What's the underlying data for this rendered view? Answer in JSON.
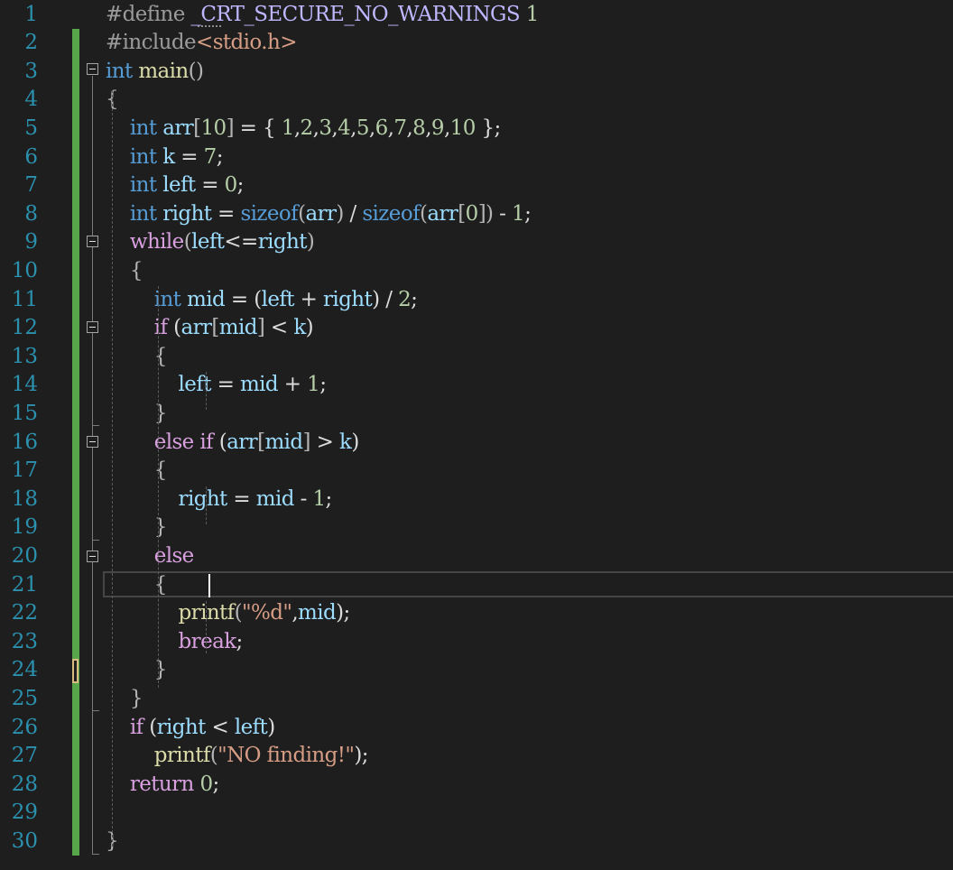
{
  "editor": {
    "language": "C",
    "theme_colors": {
      "background": "#1e1e1e",
      "line_number": "#2b91af",
      "keyword": "#569cd6",
      "control": "#d8a0df",
      "function": "#dcdcaa",
      "variable": "#9cdcfe",
      "number": "#b5cea8",
      "string": "#d69d85",
      "preprocessor": "#9b9b9b",
      "change_bar": "#57a64a"
    },
    "cursor": {
      "line": 21,
      "column": 2
    },
    "lines": [
      {
        "n": "1",
        "tokens": [
          [
            "pp",
            "#define "
          ],
          [
            "macro",
            "_CRT_SECURE_NO_WARNINGS"
          ],
          [
            "t",
            " "
          ],
          [
            "num",
            "1"
          ]
        ]
      },
      {
        "n": "2",
        "tokens": [
          [
            "pp",
            "#include"
          ],
          [
            "str",
            "<stdio.h>"
          ]
        ]
      },
      {
        "n": "3",
        "tokens": [
          [
            "kw",
            "int"
          ],
          [
            "t",
            " "
          ],
          [
            "fn",
            "main"
          ],
          [
            "punc",
            "()"
          ]
        ]
      },
      {
        "n": "4",
        "tokens": [
          [
            "punc",
            "{"
          ]
        ]
      },
      {
        "n": "5",
        "tokens": [
          [
            "t",
            "    "
          ],
          [
            "kw",
            "int"
          ],
          [
            "t",
            " "
          ],
          [
            "var",
            "arr"
          ],
          [
            "punc",
            "["
          ],
          [
            "num",
            "10"
          ],
          [
            "punc",
            "]"
          ],
          [
            "t",
            " = { "
          ],
          [
            "num",
            "1"
          ],
          [
            "t",
            ","
          ],
          [
            "num",
            "2"
          ],
          [
            "t",
            ","
          ],
          [
            "num",
            "3"
          ],
          [
            "t",
            ","
          ],
          [
            "num",
            "4"
          ],
          [
            "t",
            ","
          ],
          [
            "num",
            "5"
          ],
          [
            "t",
            ","
          ],
          [
            "num",
            "6"
          ],
          [
            "t",
            ","
          ],
          [
            "num",
            "7"
          ],
          [
            "t",
            ","
          ],
          [
            "num",
            "8"
          ],
          [
            "t",
            ","
          ],
          [
            "num",
            "9"
          ],
          [
            "t",
            ","
          ],
          [
            "num",
            "10"
          ],
          [
            "t",
            " };"
          ]
        ]
      },
      {
        "n": "6",
        "tokens": [
          [
            "t",
            "    "
          ],
          [
            "kw",
            "int"
          ],
          [
            "t",
            " "
          ],
          [
            "var",
            "k"
          ],
          [
            "t",
            " = "
          ],
          [
            "num",
            "7"
          ],
          [
            "t",
            ";"
          ]
        ]
      },
      {
        "n": "7",
        "tokens": [
          [
            "t",
            "    "
          ],
          [
            "kw",
            "int"
          ],
          [
            "t",
            " "
          ],
          [
            "var",
            "left"
          ],
          [
            "t",
            " = "
          ],
          [
            "num",
            "0"
          ],
          [
            "t",
            ";"
          ]
        ]
      },
      {
        "n": "8",
        "tokens": [
          [
            "t",
            "    "
          ],
          [
            "kw",
            "int"
          ],
          [
            "t",
            " "
          ],
          [
            "var",
            "right"
          ],
          [
            "t",
            " = "
          ],
          [
            "kw",
            "sizeof"
          ],
          [
            "punc",
            "("
          ],
          [
            "var",
            "arr"
          ],
          [
            "punc",
            ")"
          ],
          [
            "t",
            " / "
          ],
          [
            "kw",
            "sizeof"
          ],
          [
            "punc",
            "("
          ],
          [
            "var",
            "arr"
          ],
          [
            "punc",
            "["
          ],
          [
            "num",
            "0"
          ],
          [
            "punc",
            "])"
          ],
          [
            "t",
            " - "
          ],
          [
            "num",
            "1"
          ],
          [
            "t",
            ";"
          ]
        ]
      },
      {
        "n": "9",
        "tokens": [
          [
            "t",
            "    "
          ],
          [
            "ctl",
            "while"
          ],
          [
            "punc",
            "("
          ],
          [
            "var",
            "left"
          ],
          [
            "t",
            "<="
          ],
          [
            "var",
            "right"
          ],
          [
            "punc",
            ")"
          ]
        ]
      },
      {
        "n": "10",
        "tokens": [
          [
            "t",
            "    "
          ],
          [
            "punc",
            "{"
          ]
        ]
      },
      {
        "n": "11",
        "tokens": [
          [
            "t",
            "        "
          ],
          [
            "kw",
            "int"
          ],
          [
            "t",
            " "
          ],
          [
            "var",
            "mid"
          ],
          [
            "t",
            " = ("
          ],
          [
            "var",
            "left"
          ],
          [
            "t",
            " + "
          ],
          [
            "var",
            "right"
          ],
          [
            "t",
            ") / "
          ],
          [
            "num",
            "2"
          ],
          [
            "t",
            ";"
          ]
        ]
      },
      {
        "n": "12",
        "tokens": [
          [
            "t",
            "        "
          ],
          [
            "ctl",
            "if"
          ],
          [
            "t",
            " ("
          ],
          [
            "var",
            "arr"
          ],
          [
            "punc",
            "["
          ],
          [
            "var",
            "mid"
          ],
          [
            "punc",
            "]"
          ],
          [
            "t",
            " < "
          ],
          [
            "var",
            "k"
          ],
          [
            "t",
            ")"
          ]
        ]
      },
      {
        "n": "13",
        "tokens": [
          [
            "t",
            "        "
          ],
          [
            "punc",
            "{"
          ]
        ]
      },
      {
        "n": "14",
        "tokens": [
          [
            "t",
            "            "
          ],
          [
            "var",
            "left"
          ],
          [
            "t",
            " = "
          ],
          [
            "var",
            "mid"
          ],
          [
            "t",
            " + "
          ],
          [
            "num",
            "1"
          ],
          [
            "t",
            ";"
          ]
        ]
      },
      {
        "n": "15",
        "tokens": [
          [
            "t",
            "        "
          ],
          [
            "punc",
            "}"
          ]
        ]
      },
      {
        "n": "16",
        "tokens": [
          [
            "t",
            "        "
          ],
          [
            "ctl",
            "else if"
          ],
          [
            "t",
            " ("
          ],
          [
            "var",
            "arr"
          ],
          [
            "punc",
            "["
          ],
          [
            "var",
            "mid"
          ],
          [
            "punc",
            "]"
          ],
          [
            "t",
            " > "
          ],
          [
            "var",
            "k"
          ],
          [
            "t",
            ")"
          ]
        ]
      },
      {
        "n": "17",
        "tokens": [
          [
            "t",
            "        "
          ],
          [
            "punc",
            "{"
          ]
        ]
      },
      {
        "n": "18",
        "tokens": [
          [
            "t",
            "            "
          ],
          [
            "var",
            "right"
          ],
          [
            "t",
            " = "
          ],
          [
            "var",
            "mid"
          ],
          [
            "t",
            " - "
          ],
          [
            "num",
            "1"
          ],
          [
            "t",
            ";"
          ]
        ]
      },
      {
        "n": "19",
        "tokens": [
          [
            "t",
            "        "
          ],
          [
            "punc",
            "}"
          ]
        ]
      },
      {
        "n": "20",
        "tokens": [
          [
            "t",
            "        "
          ],
          [
            "ctl",
            "else"
          ]
        ]
      },
      {
        "n": "21",
        "tokens": [
          [
            "t",
            "        "
          ],
          [
            "punc",
            "{"
          ]
        ]
      },
      {
        "n": "22",
        "tokens": [
          [
            "t",
            "            "
          ],
          [
            "fn",
            "printf"
          ],
          [
            "punc",
            "("
          ],
          [
            "str",
            "\"%d\""
          ],
          [
            "t",
            ","
          ],
          [
            "var",
            "mid"
          ],
          [
            "t",
            ");"
          ]
        ]
      },
      {
        "n": "23",
        "tokens": [
          [
            "t",
            "            "
          ],
          [
            "ctl",
            "break"
          ],
          [
            "t",
            ";"
          ]
        ]
      },
      {
        "n": "24",
        "tokens": [
          [
            "t",
            "        "
          ],
          [
            "punc",
            "}"
          ]
        ]
      },
      {
        "n": "25",
        "tokens": [
          [
            "t",
            "    "
          ],
          [
            "punc",
            "}"
          ]
        ]
      },
      {
        "n": "26",
        "tokens": [
          [
            "t",
            "    "
          ],
          [
            "ctl",
            "if"
          ],
          [
            "t",
            " ("
          ],
          [
            "var",
            "right"
          ],
          [
            "t",
            " < "
          ],
          [
            "var",
            "left"
          ],
          [
            "t",
            ")"
          ]
        ]
      },
      {
        "n": "27",
        "tokens": [
          [
            "t",
            "        "
          ],
          [
            "fn",
            "printf"
          ],
          [
            "punc",
            "("
          ],
          [
            "str",
            "\"NO finding!\""
          ],
          [
            "t",
            ");"
          ]
        ]
      },
      {
        "n": "28",
        "tokens": [
          [
            "t",
            "    "
          ],
          [
            "ctl",
            "return"
          ],
          [
            "t",
            " "
          ],
          [
            "num",
            "0"
          ],
          [
            "t",
            ";"
          ]
        ]
      },
      {
        "n": "29",
        "tokens": []
      },
      {
        "n": "30",
        "tokens": [
          [
            "punc",
            "}"
          ]
        ]
      }
    ]
  }
}
